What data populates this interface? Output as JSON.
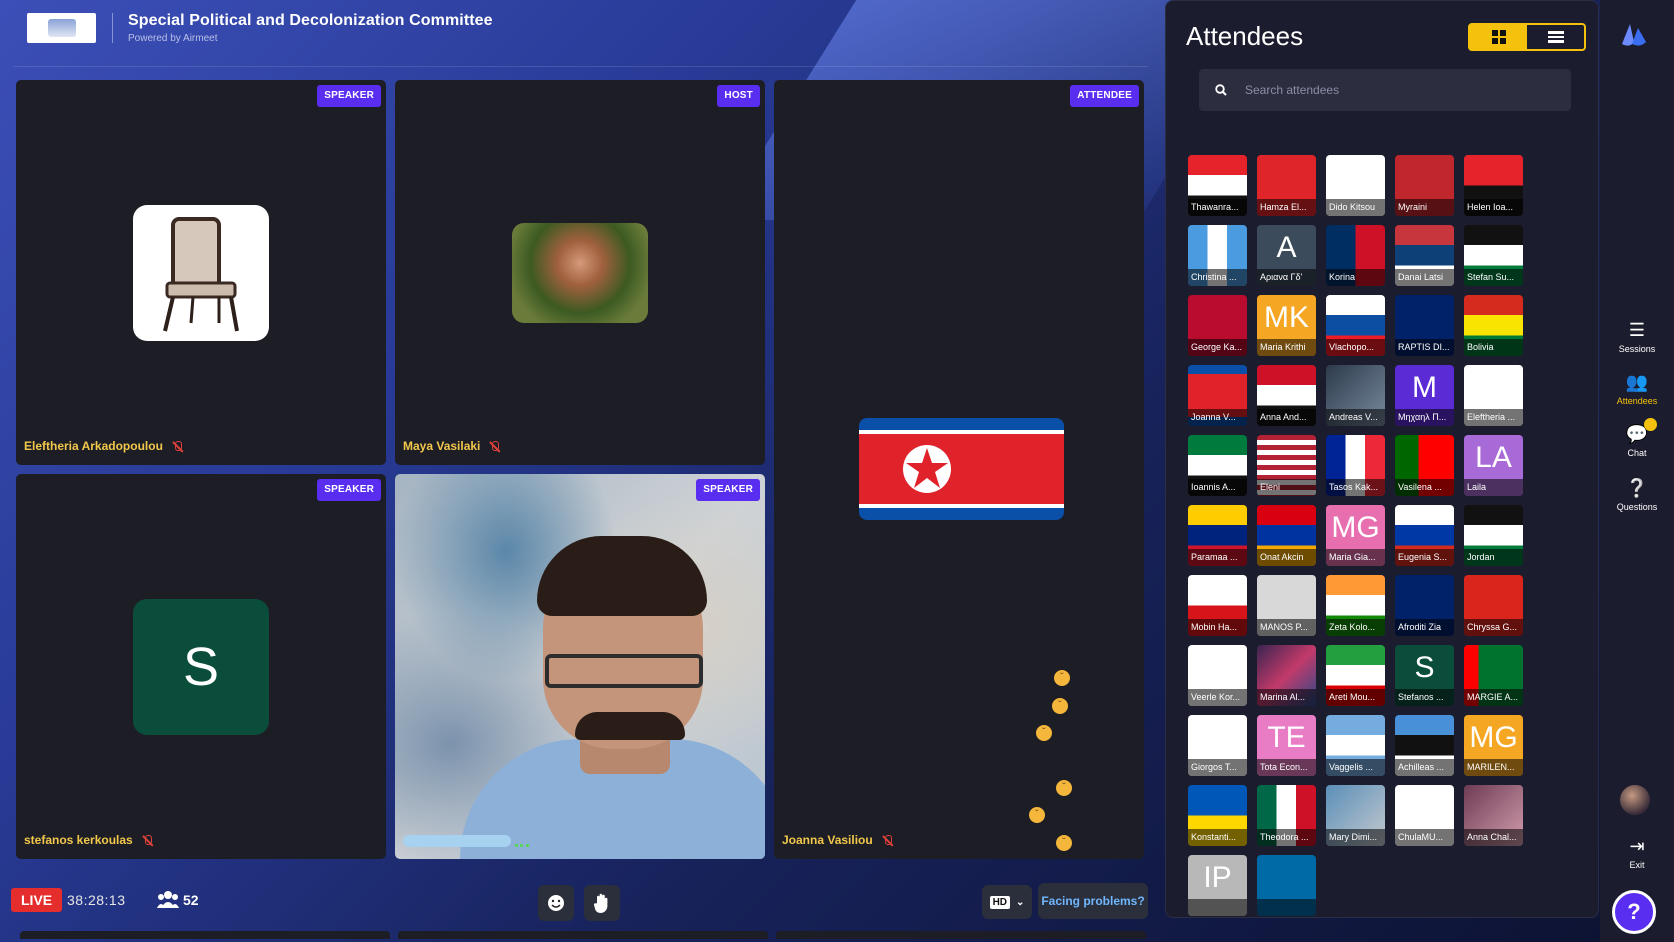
{
  "header": {
    "title": "Special Political and Decolonization Committee",
    "powered_by": "Powered by Airmeet"
  },
  "stage": {
    "tiles": [
      {
        "name": "Eleftheria Arkadopoulou",
        "role": "SPEAKER"
      },
      {
        "name": "Maya Vasilaki",
        "role": "HOST"
      },
      {
        "name": "Joanna Vasiliou",
        "role": "ATTENDEE"
      },
      {
        "name": "stefanos kerkoulas",
        "role": "SPEAKER",
        "avatar_letter": "S"
      },
      {
        "name": "",
        "role": "SPEAKER"
      }
    ]
  },
  "bottom_bar": {
    "live_label": "LIVE",
    "timer": "38:28:13",
    "participant_count": "52",
    "quality": "HD",
    "facing_problems": "Facing problems?"
  },
  "attendees_panel": {
    "title": "Attendees",
    "search_placeholder": "Search attendees",
    "attendees": [
      {
        "name": "Thawanra..."
      },
      {
        "name": "Hamza El..."
      },
      {
        "name": "Dido Kitsou"
      },
      {
        "name": "Myraini"
      },
      {
        "name": "Helen Ioa..."
      },
      {
        "name": "Christina ..."
      },
      {
        "name": "Αριανα Γδ'",
        "initials": "A"
      },
      {
        "name": "Korina"
      },
      {
        "name": "Danai Latsi"
      },
      {
        "name": "Stefan Su..."
      },
      {
        "name": "George Ka..."
      },
      {
        "name": "Maria Krithi",
        "initials": "MK"
      },
      {
        "name": "Vlachopo..."
      },
      {
        "name": "RAPTIS DI..."
      },
      {
        "name": "Bolivia"
      },
      {
        "name": "Joanna V..."
      },
      {
        "name": "Anna And..."
      },
      {
        "name": "Andreas V..."
      },
      {
        "name": "Μηχαηλ Π...",
        "initials": "M"
      },
      {
        "name": "Eleftheria ..."
      },
      {
        "name": "Ioannis A..."
      },
      {
        "name": "Eleni"
      },
      {
        "name": "Tasos Kak..."
      },
      {
        "name": "Vasilena ..."
      },
      {
        "name": "Laila",
        "initials": "LA"
      },
      {
        "name": "Paramaa ..."
      },
      {
        "name": "Onat Akcin"
      },
      {
        "name": "Maria Gia...",
        "initials": "MG"
      },
      {
        "name": "Eugenia S..."
      },
      {
        "name": "Jordan"
      },
      {
        "name": "Mobin Ha..."
      },
      {
        "name": "MANOS P..."
      },
      {
        "name": "Zeta Kolo..."
      },
      {
        "name": "Afroditi Zia"
      },
      {
        "name": "Chryssa G..."
      },
      {
        "name": "Veerle Kor..."
      },
      {
        "name": "Marina Al..."
      },
      {
        "name": "Areti Mou..."
      },
      {
        "name": "Stefanos ...",
        "initials": "S"
      },
      {
        "name": "MARGIE A..."
      },
      {
        "name": "Giorgos T..."
      },
      {
        "name": "Tota Econ...",
        "initials": "TE"
      },
      {
        "name": "Vaggelis ..."
      },
      {
        "name": "Achilleas ..."
      },
      {
        "name": "MARILEN...",
        "initials": "MG"
      },
      {
        "name": "Konstanti..."
      },
      {
        "name": "Theodora ..."
      },
      {
        "name": "Mary Dimi..."
      },
      {
        "name": "ChulaMU..."
      },
      {
        "name": "Anna Chal..."
      },
      {
        "name": "",
        "initials": "IP"
      },
      {
        "name": ""
      }
    ]
  },
  "rail": {
    "sessions": "Sessions",
    "attendees": "Attendees",
    "chat": "Chat",
    "questions": "Questions",
    "exit": "Exit",
    "help": "?"
  },
  "colors": {
    "accent_purple": "#5a2ef0",
    "accent_yellow": "#f4c20d",
    "live_red": "#e52d2d",
    "name_yellow": "#f2c84b"
  }
}
